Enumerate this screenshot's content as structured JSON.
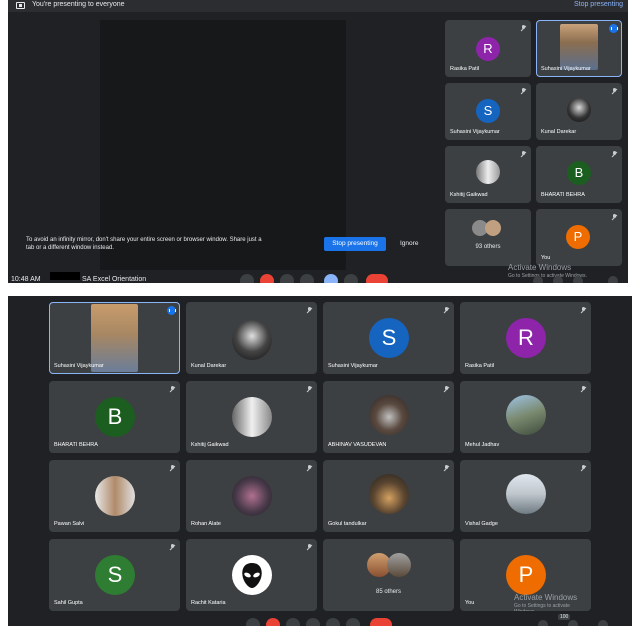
{
  "top": {
    "banner_text": "You're presenting to everyone",
    "banner_stop": "Stop presenting",
    "warning": "To avoid an infinity mirror, don't share your entire screen or browser window. Share just a tab or a different window instead.",
    "stop_button": "Stop presenting",
    "ignore_button": "Ignore",
    "clock": "10:48 AM",
    "meeting_title": "SA Excel Orientation",
    "activate_windows": "Activate Windows",
    "activate_settings": "Go to Settings to activate Windows.",
    "tiles": [
      {
        "name": "Rasika Patil",
        "initial": "R",
        "color": "#8e24aa"
      },
      {
        "name": "Suhasini Vijaykumar",
        "initial": "",
        "color": ""
      },
      {
        "name": "Suhasini Vijaykumar",
        "initial": "S",
        "color": "#1565c0"
      },
      {
        "name": "Kunal Darekar",
        "initial": "",
        "color": ""
      },
      {
        "name": "Kshitij Gaikwad",
        "initial": "",
        "color": ""
      },
      {
        "name": "BHARATI BEHRA",
        "initial": "B",
        "color": "#1b5e20"
      },
      {
        "name": "93 others",
        "initial": "",
        "color": ""
      },
      {
        "name": "You",
        "initial": "P",
        "color": "#ef6c00"
      }
    ]
  },
  "bottom": {
    "count_badge": "100",
    "activate_windows": "Activate Windows",
    "activate_settings": "Go to Settings to activate Windows.",
    "tiles": [
      {
        "name": "Suhasini Vijaykumar",
        "initial": "",
        "color": ""
      },
      {
        "name": "Kunal Darekar",
        "initial": "",
        "color": ""
      },
      {
        "name": "Suhasini Vijaykumar",
        "initial": "S",
        "color": "#1565c0"
      },
      {
        "name": "Rasika Patil",
        "initial": "R",
        "color": "#8e24aa"
      },
      {
        "name": "BHARATI BEHRA",
        "initial": "B",
        "color": "#1b5e20"
      },
      {
        "name": "Kshitij Gaikwad",
        "initial": "",
        "color": ""
      },
      {
        "name": "ABHINAV VASUDEVAN",
        "initial": "",
        "color": ""
      },
      {
        "name": "Mehul Jadhav",
        "initial": "",
        "color": ""
      },
      {
        "name": "Pawan Salvi",
        "initial": "",
        "color": ""
      },
      {
        "name": "Rohan Alate",
        "initial": "",
        "color": ""
      },
      {
        "name": "Gokul tandulkar",
        "initial": "",
        "color": ""
      },
      {
        "name": "Vishal Gadge",
        "initial": "",
        "color": ""
      },
      {
        "name": "Sahil Gupta",
        "initial": "S",
        "color": "#2e7d32"
      },
      {
        "name": "Rachit Kataria",
        "initial": "",
        "color": ""
      },
      {
        "name": "85 others",
        "initial": "",
        "color": ""
      },
      {
        "name": "You",
        "initial": "P",
        "color": "#ef6c00"
      }
    ]
  },
  "colors": {
    "background": "#202124",
    "tile": "#3c4043",
    "accent": "#1a73e8",
    "end_call": "#ea4335"
  }
}
